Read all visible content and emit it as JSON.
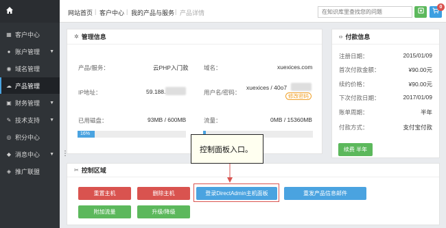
{
  "sidebar": {
    "items": [
      {
        "label": "客户中心",
        "icon": "grid-icon",
        "caret": false
      },
      {
        "label": "账户管理",
        "icon": "user-icon",
        "caret": true
      },
      {
        "label": "域名管理",
        "icon": "globe-icon",
        "caret": false
      },
      {
        "label": "产品管理",
        "icon": "cloud-icon",
        "caret": false,
        "active": true
      },
      {
        "label": "财务管理",
        "icon": "wallet-icon",
        "caret": true
      },
      {
        "label": "技术支持",
        "icon": "wrench-icon",
        "caret": true
      },
      {
        "label": "积分中心",
        "icon": "coin-icon",
        "caret": false
      },
      {
        "label": "消息中心",
        "icon": "bell-icon",
        "caret": true
      },
      {
        "label": "推广联盟",
        "icon": "share-icon",
        "caret": false
      }
    ]
  },
  "topbar": {
    "breadcrumbs": [
      "网站首页",
      "客户中心",
      "我的产品与服务",
      "产品详情"
    ],
    "search_placeholder": "在知识库里查找您的问题",
    "cart_count": "0"
  },
  "management": {
    "title": "管理信息",
    "product_label": "产品/服务：",
    "product_value": "云PHP入门款",
    "domain_label": "域名：",
    "domain_value": "xuexices.com",
    "ip_label": "IP地址：",
    "ip_value": "59.188.",
    "user_label": "用户名/密码：",
    "user_value": "xuexices / 40o7",
    "change_password": "修改密码",
    "disk_label": "已用磁盘：",
    "disk_value": "93MB / 600MB",
    "disk_percent": "16%",
    "disk_fraction": 0.16,
    "traffic_label": "流量：",
    "traffic_value": "0MB / 15360MB",
    "traffic_fraction": 0.0
  },
  "payment": {
    "title": "付款信息",
    "rows": [
      {
        "label": "注册日期：",
        "value": "2015/01/09"
      },
      {
        "label": "首次付款金额：",
        "value": "¥90.00元"
      },
      {
        "label": "续约价格：",
        "value": "¥90.00元"
      },
      {
        "label": "下次付款日期：",
        "value": "2017/01/09"
      },
      {
        "label": "账单周期：",
        "value": "半年"
      },
      {
        "label": "付款方式：",
        "value": "支付宝付款"
      }
    ],
    "renew_button": "续费 半年"
  },
  "control": {
    "title": "控制区域",
    "buttons": {
      "reboot": "重置主机",
      "delete": "删除主机",
      "login_directadmin": "登录DirectAdmin主机面板",
      "resend_info": "重发产品信息邮件",
      "add_traffic": "附加流量",
      "upgrade": "升级/降级"
    }
  },
  "annotation": {
    "callout": "控制面板入口。"
  },
  "colors": {
    "sidebar_bg": "#2f3337",
    "accent_blue": "#4aa3e0",
    "red": "#d9534f",
    "green": "#5cb85c"
  }
}
